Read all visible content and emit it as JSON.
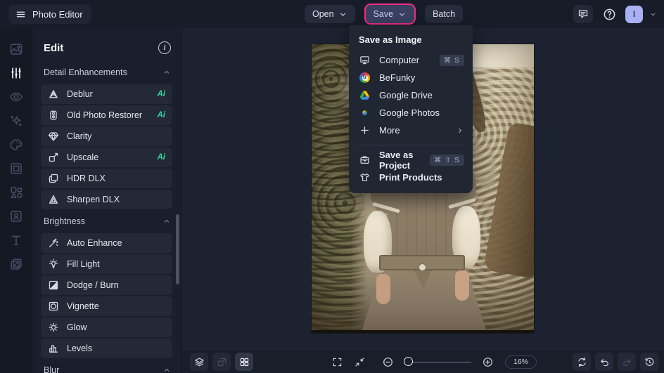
{
  "app": {
    "title": "Photo Editor"
  },
  "topbar": {
    "open": "Open",
    "save": "Save",
    "batch": "Batch",
    "avatar_initial": "I"
  },
  "save_menu": {
    "header": "Save as Image",
    "items": [
      {
        "label": "Computer",
        "icon": "computer",
        "shortcut": "⌘ S",
        "submenu": false
      },
      {
        "label": "BeFunky",
        "icon": "befunky",
        "shortcut": "",
        "submenu": false
      },
      {
        "label": "Google Drive",
        "icon": "google-drive",
        "shortcut": "",
        "submenu": false
      },
      {
        "label": "Google Photos",
        "icon": "google-photos",
        "shortcut": "",
        "submenu": false
      },
      {
        "label": "More",
        "icon": "plus",
        "shortcut": "",
        "submenu": true
      }
    ],
    "project_items": [
      {
        "label": "Save as Project",
        "icon": "briefcase",
        "shortcut": "⌘ ⇧ S"
      },
      {
        "label": "Print Products",
        "icon": "tshirt",
        "shortcut": ""
      }
    ]
  },
  "rail": {
    "items": [
      {
        "name": "image-manager",
        "icon": "image",
        "active": false
      },
      {
        "name": "edit",
        "icon": "sliders",
        "active": true
      },
      {
        "name": "touch-up",
        "icon": "eye",
        "active": false
      },
      {
        "name": "effects",
        "icon": "sparkles",
        "active": false
      },
      {
        "name": "artsy",
        "icon": "palette",
        "active": false
      },
      {
        "name": "frames",
        "icon": "frame",
        "active": false
      },
      {
        "name": "graphics",
        "icon": "shapes",
        "active": false
      },
      {
        "name": "overlays",
        "icon": "overlay",
        "active": false
      },
      {
        "name": "text",
        "icon": "text",
        "active": false
      },
      {
        "name": "textures",
        "icon": "texture",
        "active": false
      }
    ]
  },
  "edit_panel": {
    "title": "Edit",
    "ai_badge": "Ai",
    "sections": [
      {
        "title": "Detail Enhancements",
        "items": [
          {
            "label": "Deblur",
            "icon": "deblur",
            "ai": true
          },
          {
            "label": "Old Photo Restorer",
            "icon": "old-photo",
            "ai": true
          },
          {
            "label": "Clarity",
            "icon": "clarity",
            "ai": false
          },
          {
            "label": "Upscale",
            "icon": "upscale",
            "ai": true
          },
          {
            "label": "HDR DLX",
            "icon": "hdr",
            "ai": false
          },
          {
            "label": "Sharpen DLX",
            "icon": "sharpen",
            "ai": false
          }
        ]
      },
      {
        "title": "Brightness",
        "items": [
          {
            "label": "Auto Enhance",
            "icon": "wand",
            "ai": false
          },
          {
            "label": "Fill Light",
            "icon": "bulb",
            "ai": false
          },
          {
            "label": "Dodge / Burn",
            "icon": "dodge",
            "ai": false
          },
          {
            "label": "Vignette",
            "icon": "vignette",
            "ai": false
          },
          {
            "label": "Glow",
            "icon": "glow",
            "ai": false
          },
          {
            "label": "Levels",
            "icon": "levels",
            "ai": false
          }
        ]
      },
      {
        "title": "Blur",
        "items": []
      }
    ]
  },
  "toolbar": {
    "zoom_level": "16%",
    "left": [
      {
        "name": "layers",
        "icon": "layers",
        "state": "normal"
      },
      {
        "name": "resize",
        "icon": "resize",
        "state": "disabled"
      },
      {
        "name": "grid-view",
        "icon": "grid",
        "state": "active"
      }
    ],
    "view": [
      {
        "name": "fullscreen",
        "icon": "fullscreen",
        "state": "plain"
      },
      {
        "name": "fit-screen",
        "icon": "fit",
        "state": "plain"
      }
    ],
    "history": [
      {
        "name": "reset",
        "icon": "reset",
        "state": "normal"
      },
      {
        "name": "undo",
        "icon": "undo",
        "state": "normal"
      },
      {
        "name": "redo",
        "icon": "redo",
        "state": "disabled"
      },
      {
        "name": "history",
        "icon": "history",
        "state": "normal"
      }
    ]
  },
  "colors": {
    "accent": "#ee2f81",
    "ai": "#36d3a2",
    "avatar": "#a9b1f2"
  }
}
